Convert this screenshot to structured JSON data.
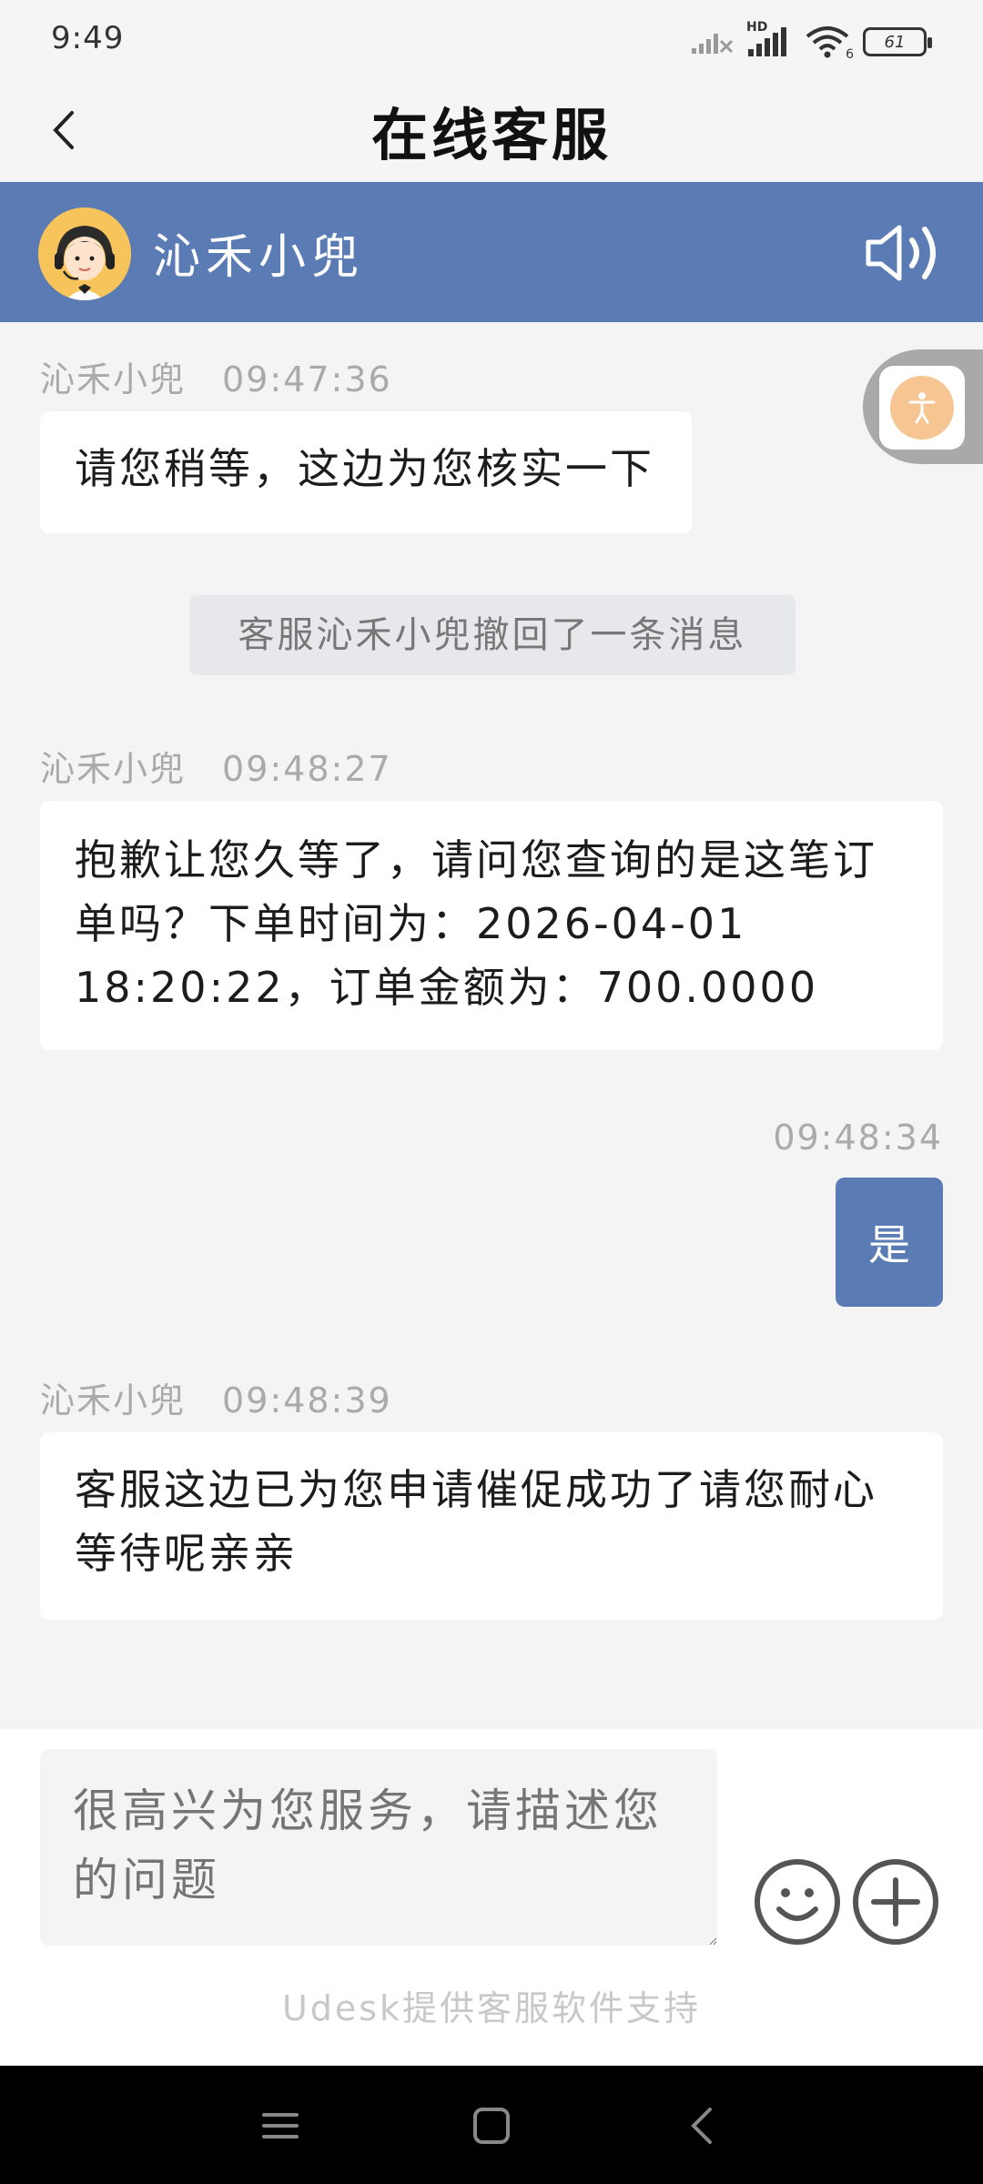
{
  "status_bar": {
    "time": "9:49",
    "network_label": "HD",
    "wifi_badge": "6",
    "battery": "61"
  },
  "header": {
    "title": "在线客服"
  },
  "agent": {
    "name": "沁禾小兜"
  },
  "messages": [
    {
      "sender": "沁禾小兜",
      "time": "09:47:36",
      "text": "请您稍等，这边为您核实一下"
    },
    {
      "system": "客服沁禾小兜撤回了一条消息"
    },
    {
      "sender": "沁禾小兜",
      "time": "09:48:27",
      "text": "抱歉让您久等了，请问您查询的是这笔订单吗？下单时间为：2026-04-01 18:20:22，订单金额为：700.0000"
    },
    {
      "time": "09:48:34",
      "text": "是"
    },
    {
      "sender": "沁禾小兜",
      "time": "09:48:39",
      "text": "客服这边已为您申请催促成功了请您耐心等待呢亲亲"
    }
  ],
  "composer": {
    "placeholder": "很高兴为您服务，请描述您的问题",
    "emoji_icon": "smiley-icon",
    "plus_icon": "plus-circle-icon"
  },
  "footer": {
    "powered_by": "Udesk提供客服软件支持"
  },
  "colors": {
    "accent": "#5a7bb4",
    "avatar_bg": "#f7c45b",
    "float_dot": "#f6c592"
  }
}
